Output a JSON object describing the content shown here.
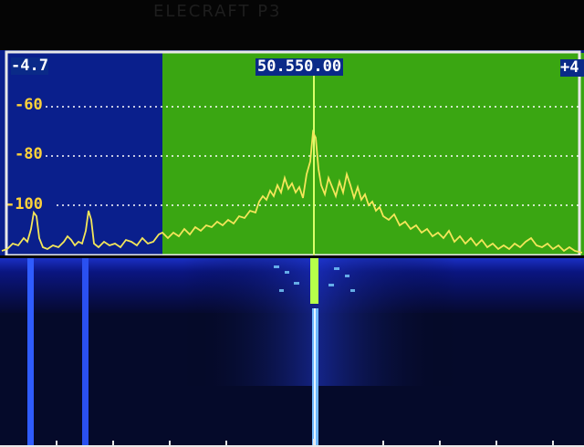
{
  "bezel_label": "ELECRAFT P3",
  "header": {
    "left_value": "-4.7",
    "center_frequency": "50.550.00",
    "right_value": "+4"
  },
  "spectrum": {
    "db_labels": [
      "-60",
      "-80",
      "-100"
    ],
    "colors": {
      "background_outside": "#0a1f8c",
      "passband": "#3aa612",
      "trace": "#f4e65a",
      "grid": "#ffffff",
      "db_text": "#ffd23a",
      "marker": "#d9ff6a"
    }
  },
  "waterfall": {
    "colors": {
      "background": "#050a2a",
      "signal": "#2f5cff",
      "carrier": "#b6ff4a"
    }
  }
}
